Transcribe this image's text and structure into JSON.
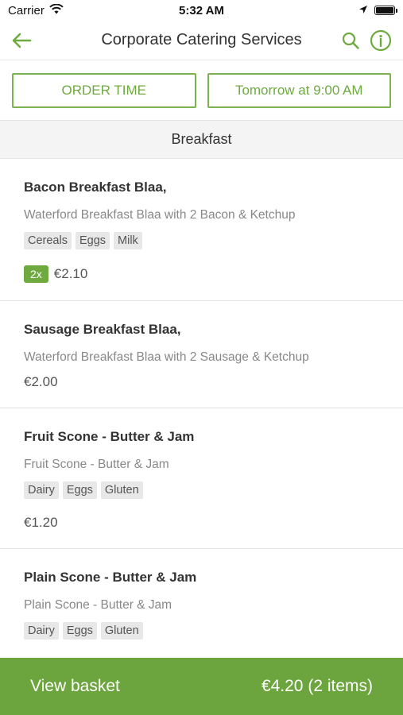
{
  "status_bar": {
    "carrier": "Carrier",
    "time": "5:32 AM"
  },
  "nav": {
    "title": "Corporate Catering Services"
  },
  "order": {
    "time_label": "ORDER TIME",
    "time_value": "Tomorrow at 9:00 AM"
  },
  "section": {
    "title": "Breakfast"
  },
  "items": [
    {
      "name": "Bacon Breakfast Blaa,",
      "description": "Waterford Breakfast Blaa with 2 Bacon & Ketchup",
      "tags": [
        "Cereals",
        "Eggs",
        "Milk"
      ],
      "quantity": "2x",
      "price": "€2.10"
    },
    {
      "name": "Sausage Breakfast Blaa,",
      "description": "Waterford Breakfast Blaa with 2 Sausage & Ketchup",
      "price": "€2.00"
    },
    {
      "name": "Fruit Scone - Butter & Jam",
      "description": "Fruit Scone - Butter & Jam",
      "tags": [
        "Dairy",
        "Eggs",
        "Gluten"
      ],
      "price": "€1.20"
    },
    {
      "name": "Plain Scone - Butter & Jam",
      "description": "Plain Scone - Butter & Jam",
      "tags": [
        "Dairy",
        "Eggs",
        "Gluten"
      ]
    }
  ],
  "basket": {
    "label": "View basket",
    "summary": "€4.20 (2 items)"
  },
  "colors": {
    "accent": "#6ca53e",
    "accent_text": "#6eaa3f"
  },
  "icons": {
    "back": "arrow-left-icon",
    "search": "search-icon",
    "info": "info-icon"
  }
}
